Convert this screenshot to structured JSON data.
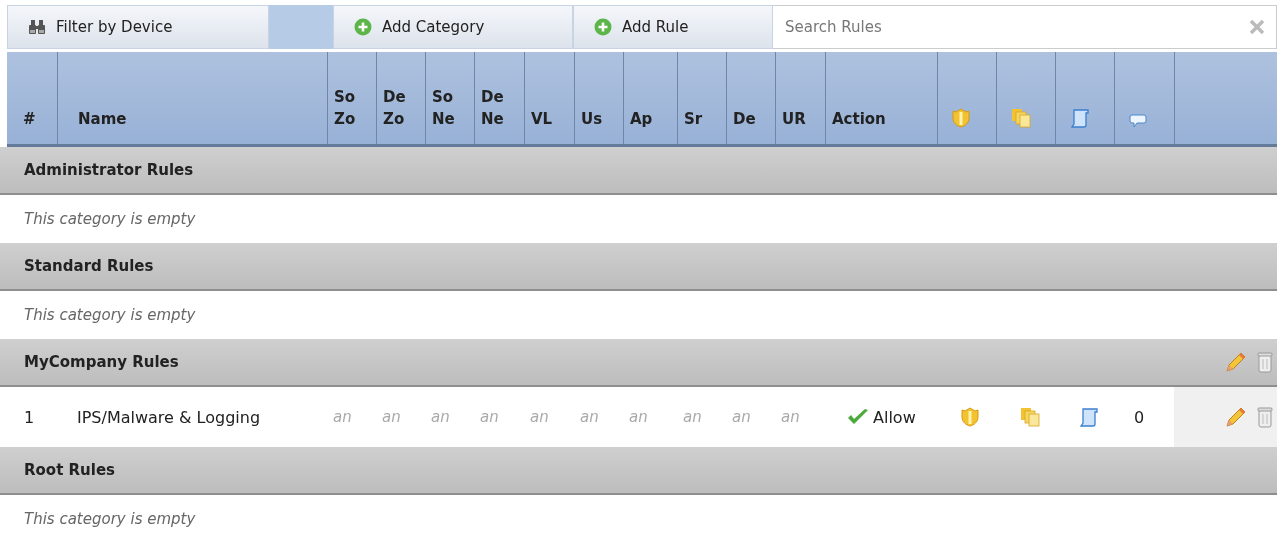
{
  "toolbar": {
    "filter_button": "Filter by Device",
    "add_category_button": "Add Category",
    "add_rule_button": "Add Rule",
    "search": {
      "placeholder": "Search Rules"
    }
  },
  "table": {
    "columns": [
      {
        "lines": [
          "#"
        ]
      },
      {
        "lines": [
          "Name"
        ]
      },
      {
        "lines": [
          "So",
          "Zo"
        ]
      },
      {
        "lines": [
          "De",
          "Zo"
        ]
      },
      {
        "lines": [
          "So",
          "Ne"
        ]
      },
      {
        "lines": [
          "De",
          "Ne"
        ]
      },
      {
        "lines": [
          "VL"
        ]
      },
      {
        "lines": [
          "Us"
        ]
      },
      {
        "lines": [
          "Ap"
        ]
      },
      {
        "lines": [
          "Sr"
        ]
      },
      {
        "lines": [
          "De"
        ]
      },
      {
        "lines": [
          "UR"
        ]
      },
      {
        "lines": [
          "Action"
        ]
      }
    ],
    "categories": [
      {
        "title": "Administrator Rules",
        "editable": false,
        "empty_note": "This category is empty"
      },
      {
        "title": "Standard Rules",
        "editable": false,
        "empty_note": "This category is empty"
      },
      {
        "title": "MyCompany Rules",
        "editable": true,
        "rules": [
          {
            "number": "1",
            "name": "IPS/Malware & Logging",
            "cells": [
              "an",
              "an",
              "an",
              "an",
              "an",
              "an",
              "an",
              "an",
              "an",
              "an"
            ],
            "action": "Allow",
            "comment_count": "0"
          }
        ]
      },
      {
        "title": "Root Rules",
        "editable": false,
        "empty_note": "This category is empty"
      }
    ]
  }
}
